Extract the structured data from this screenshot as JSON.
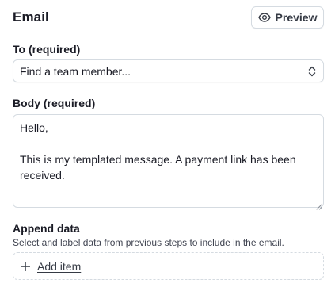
{
  "header": {
    "title": "Email",
    "preview_label": "Preview",
    "preview_icon": "eye-icon"
  },
  "to_field": {
    "label": "To (required)",
    "value": "Find a team member...",
    "icon": "chevron-up-down-icon"
  },
  "body_field": {
    "label": "Body (required)",
    "value": "Hello,\n\nThis is my templated message. A payment link has been received."
  },
  "append": {
    "title": "Append data",
    "description": "Select and label data from previous steps to include in the email.",
    "add_label": "Add item",
    "add_icon": "plus-icon"
  },
  "colors": {
    "text": "#1a1b25",
    "border": "#d5dbe1",
    "muted": "#414552"
  }
}
